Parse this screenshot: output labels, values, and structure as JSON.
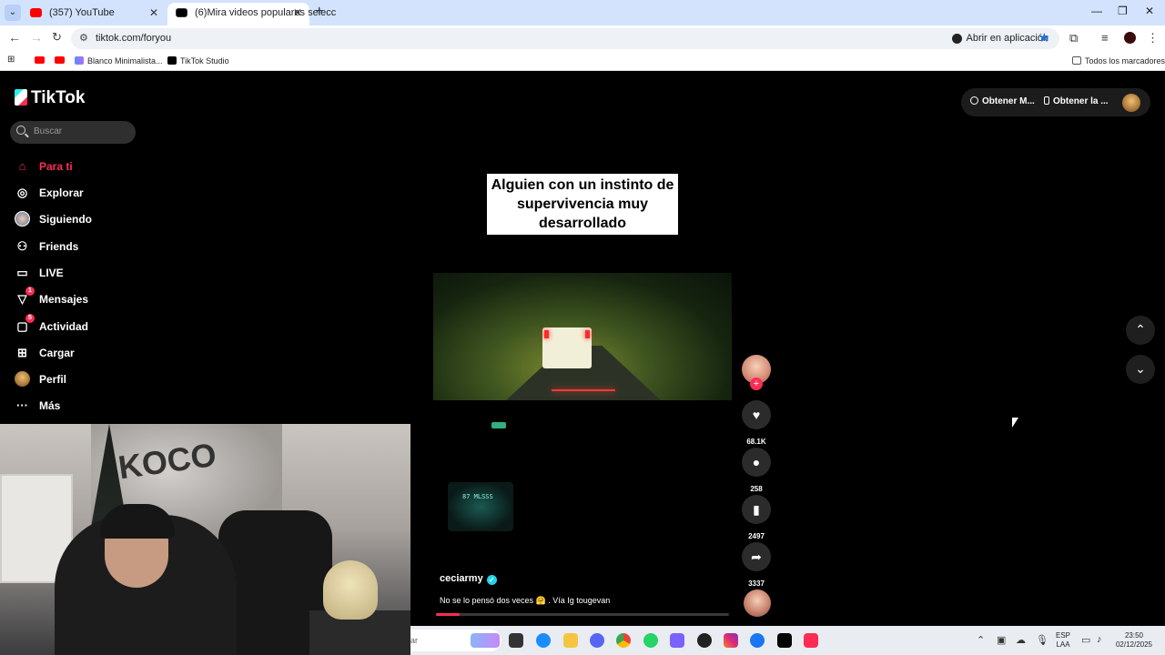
{
  "browser": {
    "tabs": [
      {
        "title": "(357) YouTube"
      },
      {
        "title": "(6)Mira videos populares selecc"
      }
    ],
    "url": "tiktok.com/foryou",
    "open_app_label": "Abrir en aplicación",
    "bookmarks": [
      "Blanco Minimalista...",
      "TikTok Studio"
    ],
    "all_bookmarks_label": "Todos los marcadores"
  },
  "tiktok": {
    "logo_text": "TikTok",
    "search_placeholder": "Buscar",
    "menu": [
      {
        "label": "Para ti",
        "icon": "home-icon",
        "active": true
      },
      {
        "label": "Explorar",
        "icon": "compass-icon"
      },
      {
        "label": "Siguiendo",
        "icon": "following-avatar"
      },
      {
        "label": "Friends",
        "icon": "friends-icon"
      },
      {
        "label": "LIVE",
        "icon": "live-icon"
      },
      {
        "label": "Mensajes",
        "icon": "messages-icon",
        "badge": "1"
      },
      {
        "label": "Actividad",
        "icon": "activity-icon",
        "badge": "5"
      },
      {
        "label": "Cargar",
        "icon": "upload-icon"
      },
      {
        "label": "Perfil",
        "icon": "profile-avatar"
      },
      {
        "label": "Más",
        "icon": "more-icon"
      }
    ],
    "top_actions": {
      "coins_label": "Obtener M...",
      "app_label": "Obtener la ..."
    },
    "video": {
      "caption_overlay": "Alguien con un instinto de supervivencia muy desarrollado",
      "radio_display": "87 MLSSS",
      "author": "ceciarmy",
      "description": "No se lo pensó dos veces 🤗 . Vía Ig tougevan",
      "progress": 0.08
    },
    "actions": {
      "likes": "68.1K",
      "comments": "258",
      "saves": "2497",
      "shares": "3337"
    }
  },
  "taskbar": {
    "search_fragment": "ar",
    "language": "ESP",
    "layout": "LAA",
    "time": "23:50",
    "date": "02/12/2025"
  },
  "colors": {
    "tiktok_red": "#fe2c55",
    "tiktok_cyan": "#25f4ee",
    "chrome_tab_bg": "#d3e3fd"
  }
}
